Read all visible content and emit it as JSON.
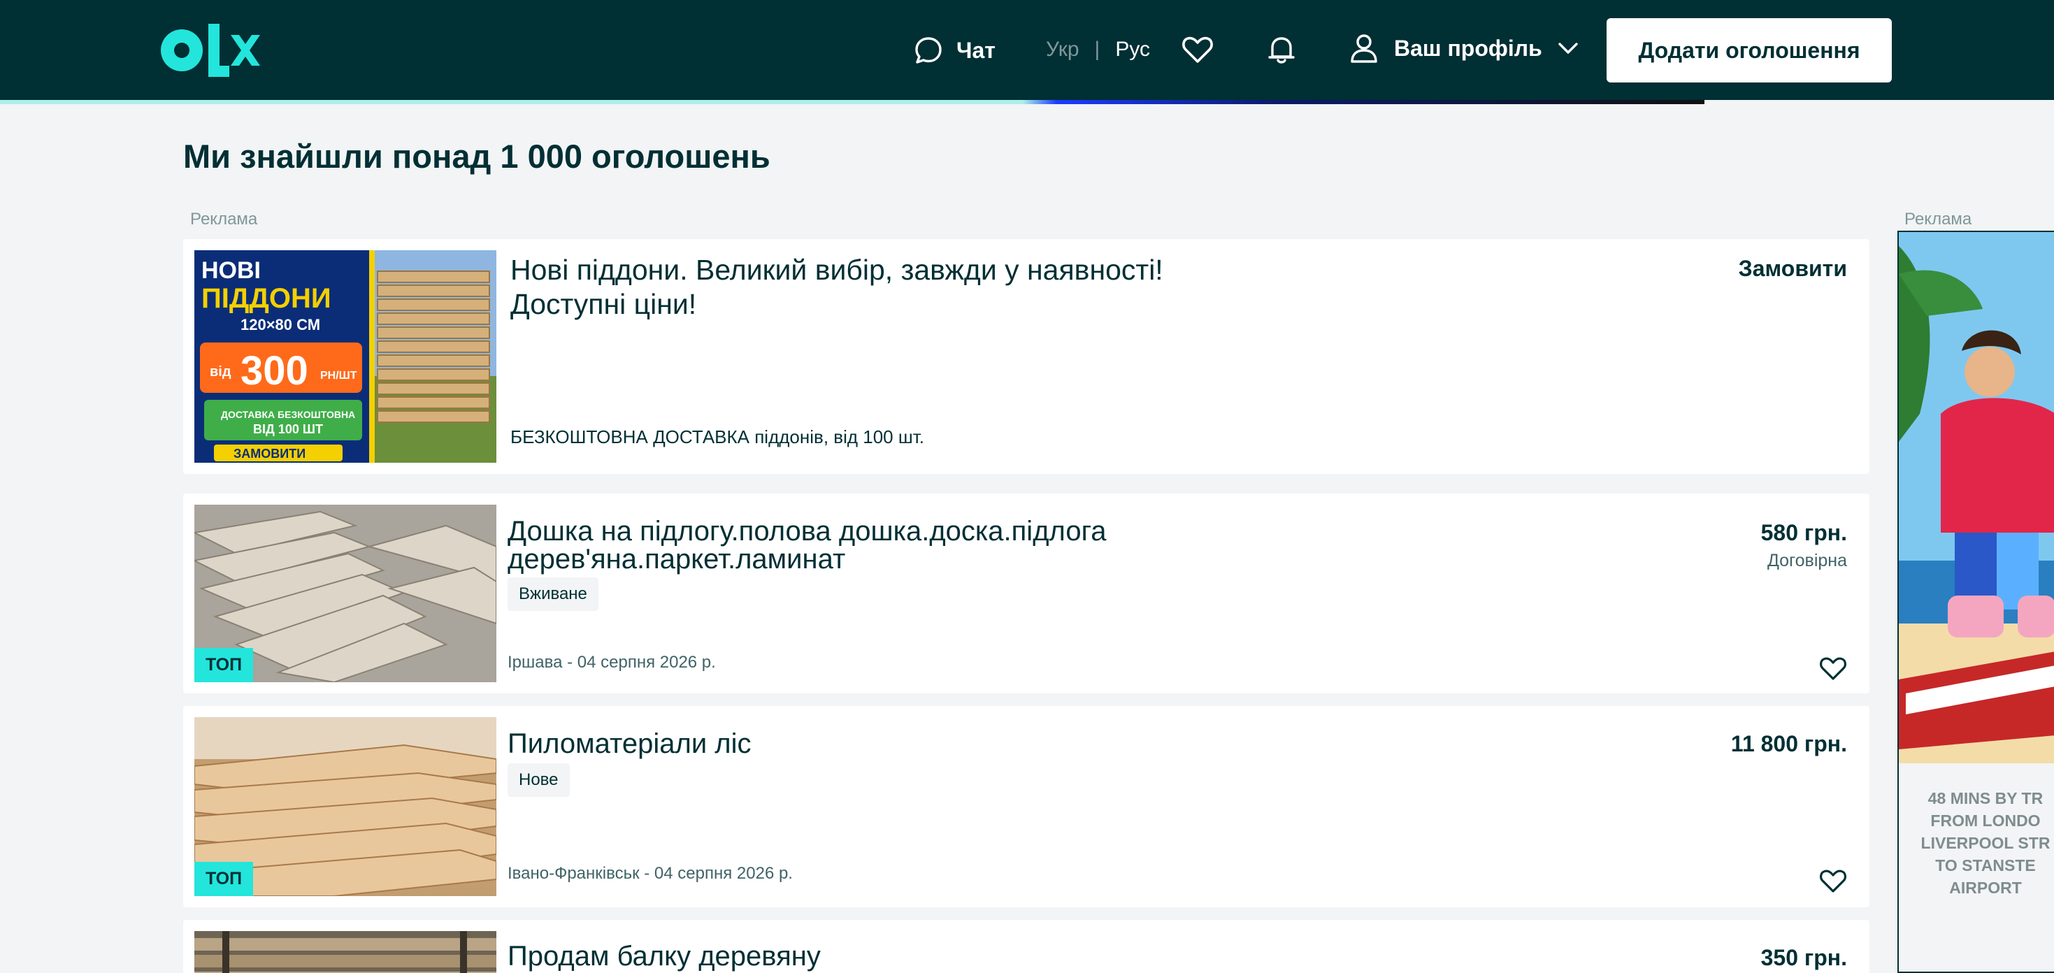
{
  "header": {
    "chat_label": "Чат",
    "lang_ukr": "Укр",
    "lang_sep": "|",
    "lang_rus": "Рус",
    "profile_label": "Ваш профіль",
    "add_button_label": "Додати оголошення"
  },
  "main": {
    "title": "Ми знайшли понад 1 000 оголошень",
    "ad_label": "Реклама",
    "side_ad_label": "Реклама"
  },
  "ad_card": {
    "title": "Нові піддони. Великий вибір, завжди у наявності! Доступні ціни!",
    "subtitle": "БЕЗКОШТОВНА ДОСТАВКА піддонів, від 100 шт.",
    "cta": "Замовити",
    "banner": {
      "line1": "НОВІ",
      "line2": "ПІДДОНИ",
      "size": "120×80 СМ",
      "from": "від",
      "price": "300",
      "unit": "РН/ШТ",
      "delivery1": "ДОСТАВКА БЕЗКОШТОВНА",
      "delivery2": "ВІД 100 ШТ",
      "button": "ЗАМОВИТИ"
    }
  },
  "listings": [
    {
      "title": "Дошка на підлогу.полова дошка.доска.підлога дерев'яна.паркет.ламинат",
      "condition": "Вживане",
      "location_date": "Іршава - 04 серпня 2026 р.",
      "price": "580 грн.",
      "negotiable": "Договірна",
      "tag": "ТОП"
    },
    {
      "title": "Пиломатеріали ліс",
      "condition": "Нове",
      "location_date": "Івано-Франківськ - 04 серпня 2026 р.",
      "price": "11 800 грн.",
      "tag": "ТОП"
    },
    {
      "title": "Продам балку деревяну",
      "price": "350 грн."
    }
  ],
  "side_ad": {
    "text": "48 MINS BY TR FROM LONDO LIVERPOOL STR TO STANSTE AIRPORT",
    "line1": "48 MINS BY TR",
    "line2": "FROM LONDO",
    "line3": "LIVERPOOL STR",
    "line4": "TO STANSTE",
    "line5": "AIRPORT"
  },
  "colors": {
    "header_bg": "#002f34",
    "accent": "#23e5db",
    "page_bg": "#f2f4f5"
  }
}
